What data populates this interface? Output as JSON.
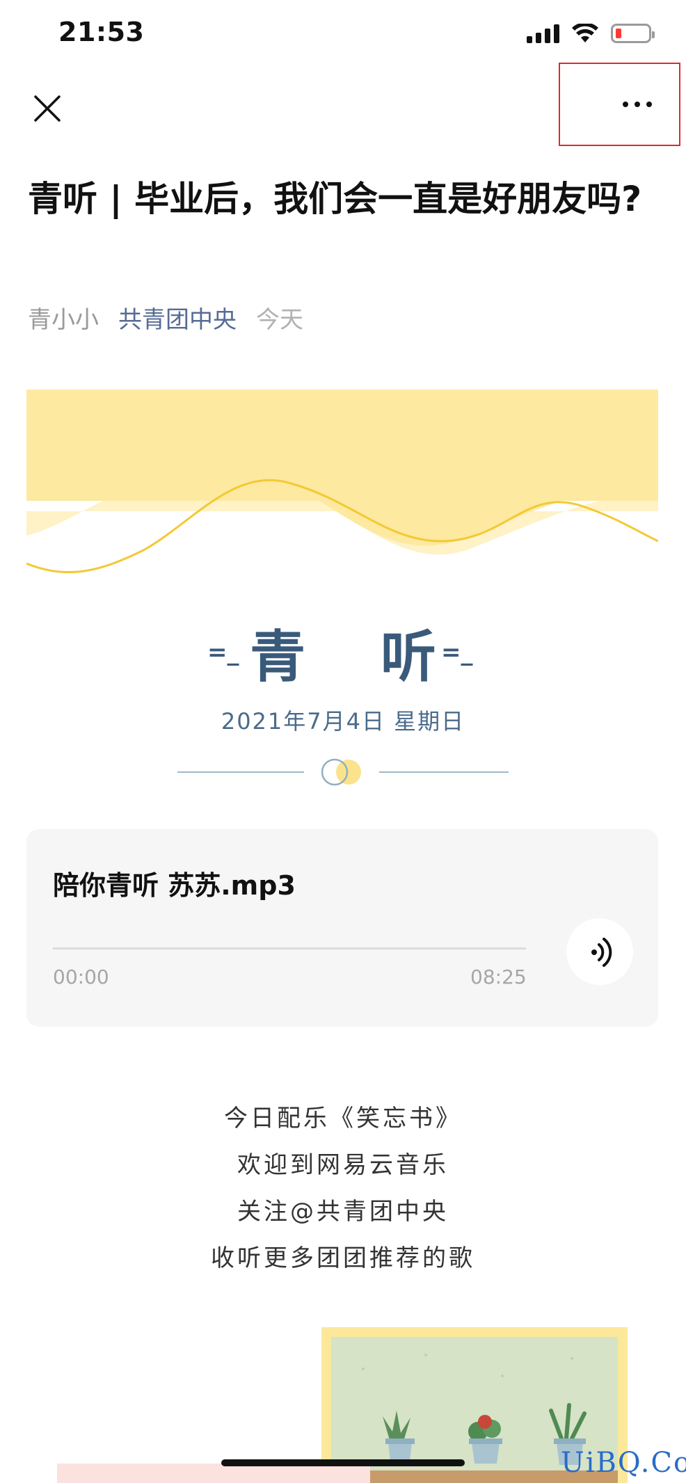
{
  "status": {
    "time": "21:53"
  },
  "nav": {
    "close_icon": "close-icon",
    "more_icon": "more-icon"
  },
  "article": {
    "title": "青听 | 毕业后，我们会一直是好朋友吗?",
    "author": "青小小",
    "account": "共青团中央",
    "date": "今天"
  },
  "section": {
    "deco_left": "=_",
    "title": "青 听",
    "deco_right": "=_",
    "date": "2021年7月4日  星期日"
  },
  "audio": {
    "name": "陪你青听  苏苏.mp3",
    "start_time": "00:00",
    "end_time": "08:25",
    "progress": 0
  },
  "text_lines": [
    "今日配乐《笑忘书》",
    "欢迎到网易云音乐",
    "关注@共青团中央",
    "收听更多团团推荐的歌"
  ],
  "watermark": "UiBQ.CoM",
  "colors": {
    "accent_blue": "#3a5a7a",
    "account_link": "#576b95",
    "banner_yellow": "#fde9a0",
    "highlight_red": "#e0282d"
  }
}
